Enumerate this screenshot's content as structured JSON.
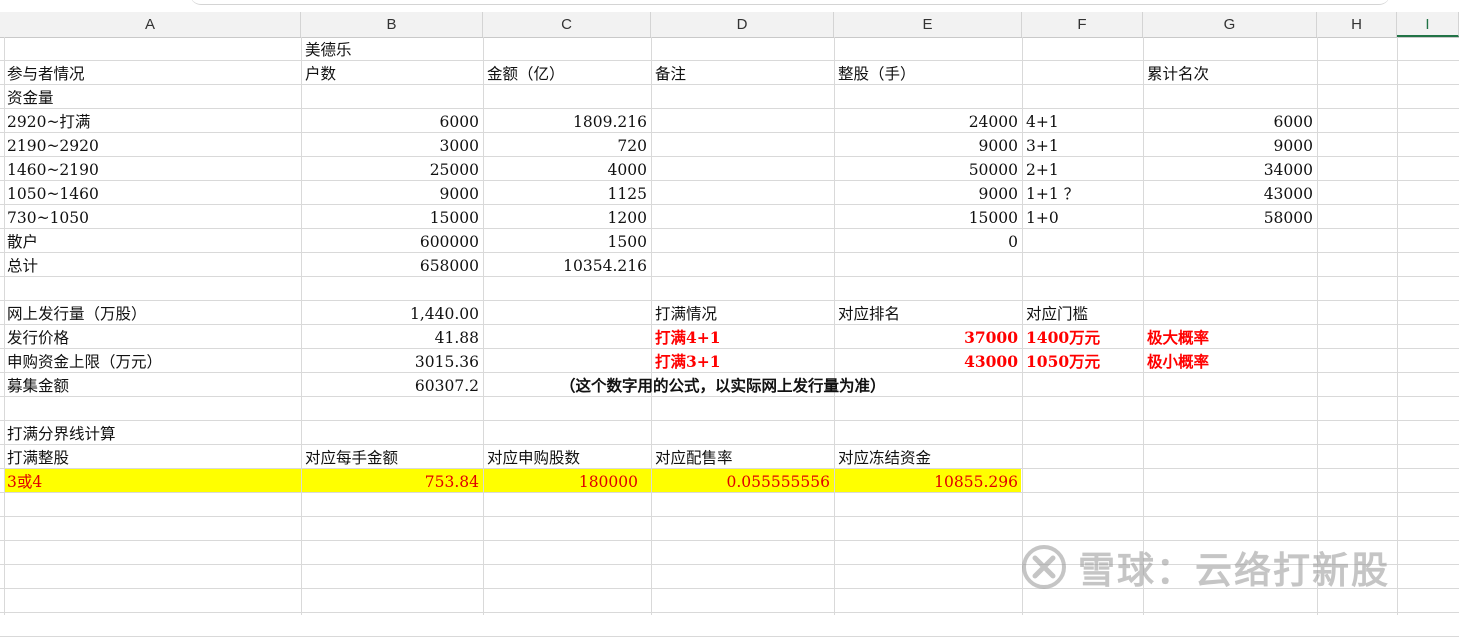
{
  "columns": [
    "A",
    "B",
    "C",
    "D",
    "E",
    "F",
    "G",
    "H",
    "I"
  ],
  "sheet": {
    "title_b": "美德乐",
    "headers": {
      "a": "参与者情况",
      "b": "户数",
      "c": "金额（亿）",
      "d": "备注",
      "e": "整股（手）",
      "g": "累计名次"
    },
    "section_zj": "资金量",
    "tiers": [
      {
        "a": "2920~打满",
        "b": "6000",
        "c": "1809.216",
        "e": "24000",
        "f": "4+1",
        "g": "6000"
      },
      {
        "a": "2190~2920",
        "b": "3000",
        "c": "720",
        "e": "9000",
        "f": "3+1",
        "g": "9000"
      },
      {
        "a": "1460~2190",
        "b": "25000",
        "c": "4000",
        "e": "50000",
        "f": "2+1",
        "g": "34000"
      },
      {
        "a": "1050~1460",
        "b": "9000",
        "c": "1125",
        "e": "9000",
        "f": "1+1 ？",
        "g": "43000"
      },
      {
        "a": "730~1050",
        "b": "15000",
        "c": "1200",
        "e": "15000",
        "f": "1+0",
        "g": "58000"
      },
      {
        "a": "散户",
        "b": "600000",
        "c": "1500",
        "e": "0",
        "f": "",
        "g": ""
      },
      {
        "a": "总计",
        "b": "658000",
        "c": "10354.216",
        "e": "",
        "f": "",
        "g": ""
      }
    ],
    "issue": [
      {
        "a": "网上发行量（万股）",
        "b": "1,440.00"
      },
      {
        "a": "发行价格",
        "b": "41.88"
      },
      {
        "a": "申购资金上限（万元）",
        "b": "3015.36"
      },
      {
        "a": "募集金额",
        "b": "60307.2"
      }
    ],
    "dama_header": {
      "d": "打满情况",
      "e": "对应排名",
      "f": "对应门槛"
    },
    "dama_rows": [
      {
        "d": "打满4+1",
        "e": "37000",
        "f": "1400万元",
        "g": "极大概率"
      },
      {
        "d": "打满3+1",
        "e": "43000",
        "f": "1050万元",
        "g": "极小概率"
      }
    ],
    "note": "（这个数字用的公式，以实际网上发行量为准）",
    "calc_title": "打满分界线计算",
    "calc_headers": {
      "a": "打满整股",
      "b": "对应每手金额",
      "c": "对应申购股数",
      "d": "对应配售率",
      "e": "对应冻结资金"
    },
    "calc_row": {
      "a": "3或4",
      "b": "753.84",
      "c": "180000",
      "d": "0.055555556",
      "e": "10855.296"
    }
  },
  "watermark": {
    "text": "雪球：云络打新股",
    "icon": "xueqiu-logo-icon"
  }
}
